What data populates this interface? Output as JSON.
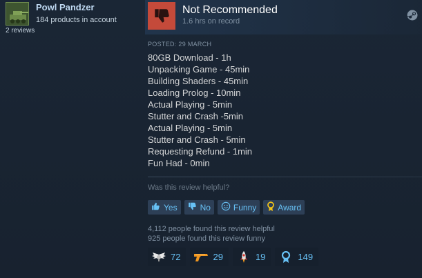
{
  "author": {
    "name": "Powl Pandzer",
    "products": "184 products in account",
    "reviews": "2 reviews"
  },
  "verdict": {
    "title": "Not Recommended",
    "hours": "1.6 hrs on record"
  },
  "review": {
    "posted": "POSTED: 29 MARCH",
    "lines": [
      "80GB Download - 1h",
      "Unpacking Game - 45min",
      "Building Shaders - 45min",
      "Loading Prolog - 10min",
      "Actual Playing - 5min",
      "Stutter and Crash -5min",
      "Actual Playing - 5min",
      "Stutter and Crash - 5min",
      "Requesting Refund - 1min",
      "Fun Had - 0min"
    ]
  },
  "feedback": {
    "question": "Was this review helpful?",
    "buttons": {
      "yes": "Yes",
      "no": "No",
      "funny": "Funny",
      "award": "Award"
    },
    "helpful_count": "4,112 people found this review helpful",
    "funny_count": "925 people found this review funny"
  },
  "awards": [
    {
      "icon": "winged-emblem-icon",
      "count": "72",
      "color": "#e8e8e8"
    },
    {
      "icon": "golden-gun-icon",
      "count": "29",
      "color": "#f0961e"
    },
    {
      "icon": "rocket-icon",
      "count": "19",
      "color": "#d8d8d8"
    },
    {
      "icon": "ribbon-medal-icon",
      "count": "149",
      "color": "#67c1f5"
    }
  ],
  "colors": {
    "background": "#1b2838",
    "thumb_down": "#c44a3a",
    "link_blue": "#67c1f5",
    "button_bg": "#2d3f56"
  }
}
